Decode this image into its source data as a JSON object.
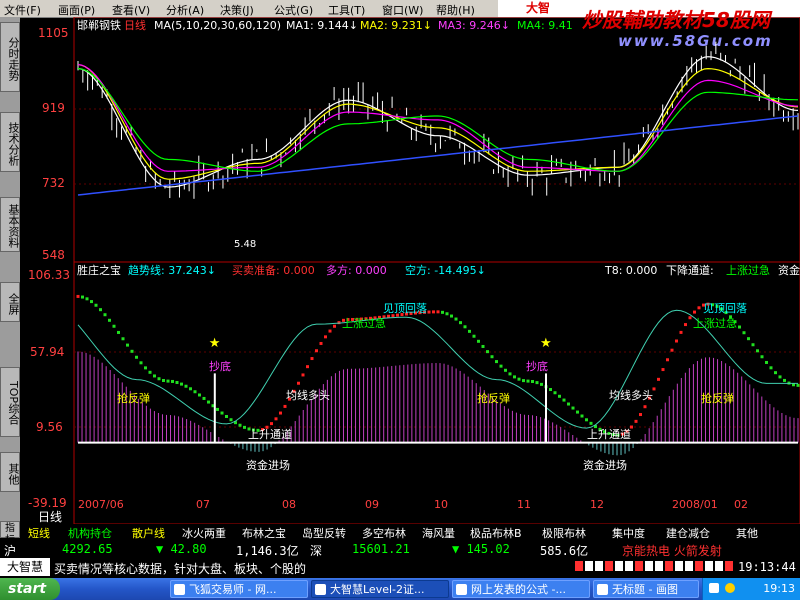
{
  "menu": {
    "items": [
      "文件(F)",
      "画面(P)",
      "查看(V)",
      "分析(A)",
      "决策(J)",
      "公式(G)",
      "工具(T)",
      "窗口(W)",
      "帮助(H)"
    ],
    "brand": "大智",
    "banner": "炒股輔助教材58股网",
    "banner_url": "www.58Gu.com"
  },
  "side_tabs": [
    "分时走势",
    "技术分析",
    "基本资料",
    "全屏",
    "TOP综合",
    "其他",
    "指标"
  ],
  "upper_chart": {
    "stock_name": "邯郸钢铁",
    "period": "日线",
    "ma_label": "MA(5,10,20,30,60,120)",
    "ma1": "MA1: 9.144↓",
    "ma2": "MA2: 9.231↓",
    "ma3": "MA3: 9.246↓",
    "ma4": "MA4: 9.41",
    "yticks": [
      "1105",
      "919",
      "732",
      "548"
    ],
    "low_marker": "5.48",
    "colors": {
      "ma1": "#ffffff",
      "ma2": "#ffff00",
      "ma3": "#ff00ff",
      "ma4": "#00ff00",
      "ma5": "#8080ff",
      "ma6": "#3050ff"
    }
  },
  "lower_chart": {
    "name": "胜庄之宝",
    "trend_label": "趋势线: 37.243↓",
    "buysell_label": "买卖准备: 0.000",
    "long_label": "多方: 0.000",
    "short_label": "空方: -14.495↓",
    "right_labels": [
      "T8: 0.000",
      "下降通道:",
      "上涨过急",
      "资金"
    ],
    "yticks": [
      "106.33",
      "57.94",
      "9.56",
      "-39.19"
    ],
    "annotations": [
      "抄底",
      "抢反弹",
      "均线多头",
      "上升通道",
      "资金进场",
      "上涨过急",
      "见顶回落",
      "抄底",
      "抢反弹",
      "均线多头",
      "上升通道",
      "资金进场",
      "见顶回落",
      "上涨过急",
      "抢反弹"
    ],
    "x_labels": [
      "2007/06",
      "07",
      "08",
      "09",
      "10",
      "11",
      "12",
      "2008/01",
      "02"
    ]
  },
  "chart_data": [
    {
      "type": "line",
      "title": "邯郸钢铁 日线",
      "ylim": [
        5.48,
        11.05
      ],
      "x": [
        "2007/06",
        "2007/07",
        "2007/08",
        "2007/09",
        "2007/10",
        "2007/11",
        "2007/12",
        "2008/01",
        "2008/02"
      ],
      "series": [
        {
          "name": "MA1",
          "values": [
            10.2,
            7.2,
            7.9,
            9.4,
            8.5,
            7.5,
            7.7,
            10.5,
            9.14
          ]
        },
        {
          "name": "MA2",
          "values": [
            10.3,
            7.4,
            7.8,
            9.3,
            8.7,
            7.6,
            7.7,
            10.2,
            9.23
          ]
        },
        {
          "name": "MA3",
          "values": [
            10.3,
            7.6,
            7.7,
            9.1,
            8.9,
            7.7,
            7.6,
            9.9,
            9.25
          ]
        },
        {
          "name": "MA4",
          "values": [
            10.2,
            7.9,
            7.6,
            8.8,
            9.0,
            7.9,
            7.6,
            9.6,
            9.41
          ]
        }
      ]
    },
    {
      "type": "line",
      "title": "胜庄之宝",
      "ylim": [
        -39.19,
        106.33
      ],
      "x": [
        "2007/06",
        "2007/07",
        "2007/08",
        "2007/09",
        "2007/10",
        "2007/11",
        "2007/12",
        "2008/01",
        "2008/02"
      ],
      "series": [
        {
          "name": "趋势线",
          "values": [
            95,
            40,
            8,
            80,
            85,
            40,
            5,
            90,
            37.24
          ]
        }
      ]
    }
  ],
  "tabstrip": [
    "短线",
    "机构持仓",
    "散户线",
    "冰火两重",
    "布林之宝",
    "岛型反转",
    "多空布林",
    "海风量",
    "极品布林B",
    "极限布林",
    "集中度",
    "建仓减仓",
    "其他"
  ],
  "status1": {
    "sh_label": "沪",
    "sh_index": "4292.65",
    "sh_change": "▼ 42.80",
    "sh_amount": "1,146.3亿",
    "sz_label": "深",
    "sz_index": "15601.21",
    "sz_change": "▼ 145.02",
    "sz_amount": "585.6亿",
    "news": "京能热电 火箭发射"
  },
  "status2": {
    "brand": "大智慧",
    "ticker": "买卖情况等核心数据，针对大盘、板块、个股的",
    "time": "19:13:44"
  },
  "taskbar": {
    "start": "start",
    "tasks": [
      "飞狐交易师 - 网...",
      "大智慧Level-2证...",
      "网上发表的公式 -...",
      "无标题 - 画图"
    ],
    "clock": "19:13"
  }
}
